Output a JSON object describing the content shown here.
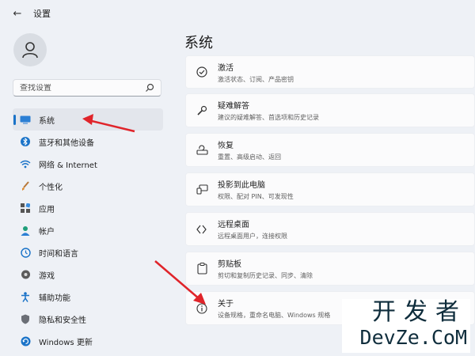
{
  "window": {
    "title": "设置"
  },
  "search": {
    "placeholder": "查找设置"
  },
  "sidebar": {
    "items": [
      {
        "label": "系统",
        "icon": "monitor-icon",
        "selected": true
      },
      {
        "label": "蓝牙和其他设备",
        "icon": "bluetooth-icon",
        "selected": false
      },
      {
        "label": "网络 & Internet",
        "icon": "wifi-icon",
        "selected": false
      },
      {
        "label": "个性化",
        "icon": "brush-icon",
        "selected": false
      },
      {
        "label": "应用",
        "icon": "apps-icon",
        "selected": false
      },
      {
        "label": "帐户",
        "icon": "person-icon",
        "selected": false
      },
      {
        "label": "时间和语言",
        "icon": "clock-globe-icon",
        "selected": false
      },
      {
        "label": "游戏",
        "icon": "gamepad-icon",
        "selected": false
      },
      {
        "label": "辅助功能",
        "icon": "accessibility-icon",
        "selected": false
      },
      {
        "label": "隐私和安全性",
        "icon": "shield-icon",
        "selected": false
      },
      {
        "label": "Windows 更新",
        "icon": "update-icon",
        "selected": false
      }
    ]
  },
  "main": {
    "title": "系统",
    "cards": [
      {
        "title": "激活",
        "desc": "激活状态、订阅、产品密钥",
        "icon": "check-circle-icon"
      },
      {
        "title": "疑难解答",
        "desc": "建议的疑难解答、首选项和历史记录",
        "icon": "wrench-icon"
      },
      {
        "title": "恢复",
        "desc": "重置、高级启动、返回",
        "icon": "recovery-icon"
      },
      {
        "title": "投影到此电脑",
        "desc": "权限、配对 PIN、可发现性",
        "icon": "projection-icon"
      },
      {
        "title": "远程桌面",
        "desc": "远程桌面用户，连接权限",
        "icon": "remote-desktop-icon"
      },
      {
        "title": "剪贴板",
        "desc": "剪切和复制历史记录、同步、清除",
        "icon": "clipboard-icon"
      },
      {
        "title": "关于",
        "desc": "设备规格，重命名电脑、Windows 规格",
        "icon": "info-icon"
      }
    ]
  },
  "watermark": {
    "cn": "开发者",
    "en": "DevZe.CoM"
  },
  "colors": {
    "accent": "#1a73c8",
    "arrow": "#e0242a",
    "background": "#eef1f6",
    "card": "#fbfbfc"
  }
}
